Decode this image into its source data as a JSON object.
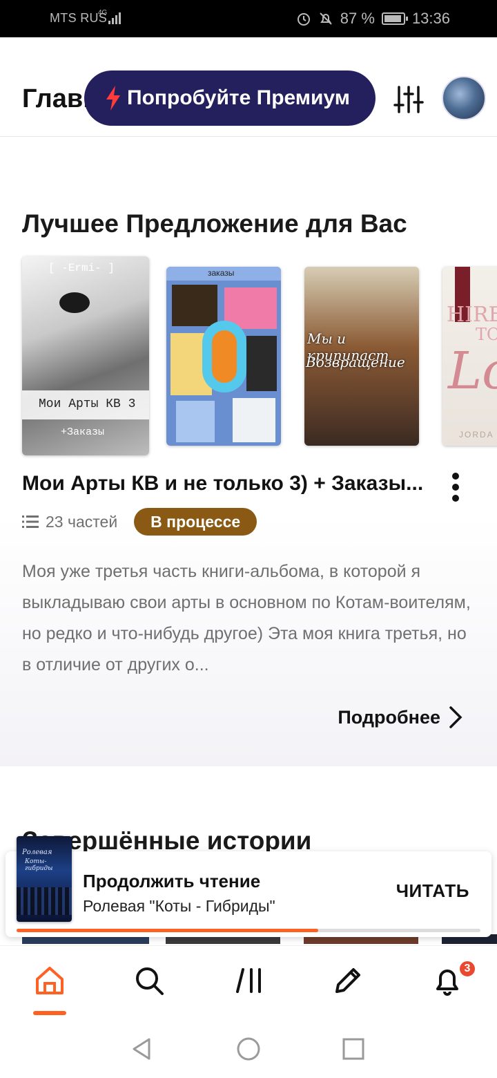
{
  "status_bar": {
    "carrier": "MTS RUS",
    "network": "4G",
    "battery": "87 %",
    "time": "13:36"
  },
  "header": {
    "title": "Главн",
    "premium_label": "Попробуйте Премиум"
  },
  "featured": {
    "section_title": "Лучшее Предложение для Вас",
    "covers": [
      {
        "top_text": "[ -Ermi- ]",
        "title": "Мои Арты КВ 3",
        "subtitle": "+Заказы"
      },
      {
        "title": "заказы"
      },
      {
        "title": "Мы и крипипаст",
        "subtitle": "Возвращение"
      },
      {
        "title": "HIRE",
        "title2": "TO",
        "title3": "Lo",
        "author": "JORDA"
      }
    ],
    "story_title": "Мои Арты КВ и не только 3) + Заказы...",
    "parts": "23 частей",
    "status": "В процессе",
    "description": "Моя уже третья часть книги-альбома, в которой я выкладываю свои арты в основном по Котам-воителям, но редко и что-нибудь другое) Эта моя книга третья, но в отличие от других о...",
    "read_more": "Подробнее"
  },
  "completed": {
    "section_title": "Завершённые истории"
  },
  "continue_reading": {
    "label": "Продолжить чтение",
    "story": "Ролевая \"Коты - Гибриды\"",
    "button": "ЧИТАТЬ",
    "cover_title": "Ролевая",
    "cover_subtitle": "Коты-гибриды",
    "progress": 0.65
  },
  "bottom_nav": {
    "items": [
      "home-icon",
      "search-icon",
      "library-icon",
      "write-icon",
      "notifications-icon"
    ],
    "notifications_count": "3",
    "active": "home"
  },
  "colors": {
    "accent": "#ff6122",
    "premium_bg": "#24205e",
    "status_badge": "#8a5a14",
    "notification_badge": "#e94a2f"
  }
}
